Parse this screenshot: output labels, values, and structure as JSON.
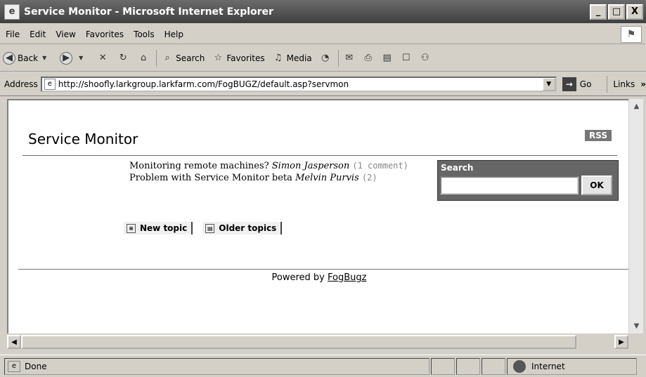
{
  "window": {
    "title": "Service Monitor - Microsoft Internet Explorer",
    "controls": [
      "_",
      "□",
      "X"
    ]
  },
  "menu": [
    "File",
    "Edit",
    "View",
    "Favorites",
    "Tools",
    "Help"
  ],
  "toolbar": {
    "back": "Back",
    "search": "Search",
    "favorites": "Favorites",
    "media": "Media"
  },
  "address": {
    "label": "Address",
    "url": "http://shoofly.larkgroup.larkfarm.com/FogBUGZ/default.asp?servmon",
    "go": "Go",
    "links": "Links",
    "links_more": "»"
  },
  "page": {
    "title": "Service Monitor",
    "rss": "RSS",
    "topics": [
      {
        "subject": "Monitoring remote machines?",
        "author": "Simon Jasperson",
        "count": "(1 comment)"
      },
      {
        "subject": "Problem with Service Monitor beta",
        "author": "Melvin Purvis",
        "count": "(2)"
      }
    ],
    "search": {
      "label": "Search",
      "ok": "OK",
      "value": ""
    },
    "buttons": {
      "new_topic": "New topic",
      "older_topics": "Older topics"
    },
    "footer": {
      "prefix": "Powered by",
      "link": "FogBugz"
    }
  },
  "status": {
    "text": "Done",
    "zone": "Internet"
  }
}
